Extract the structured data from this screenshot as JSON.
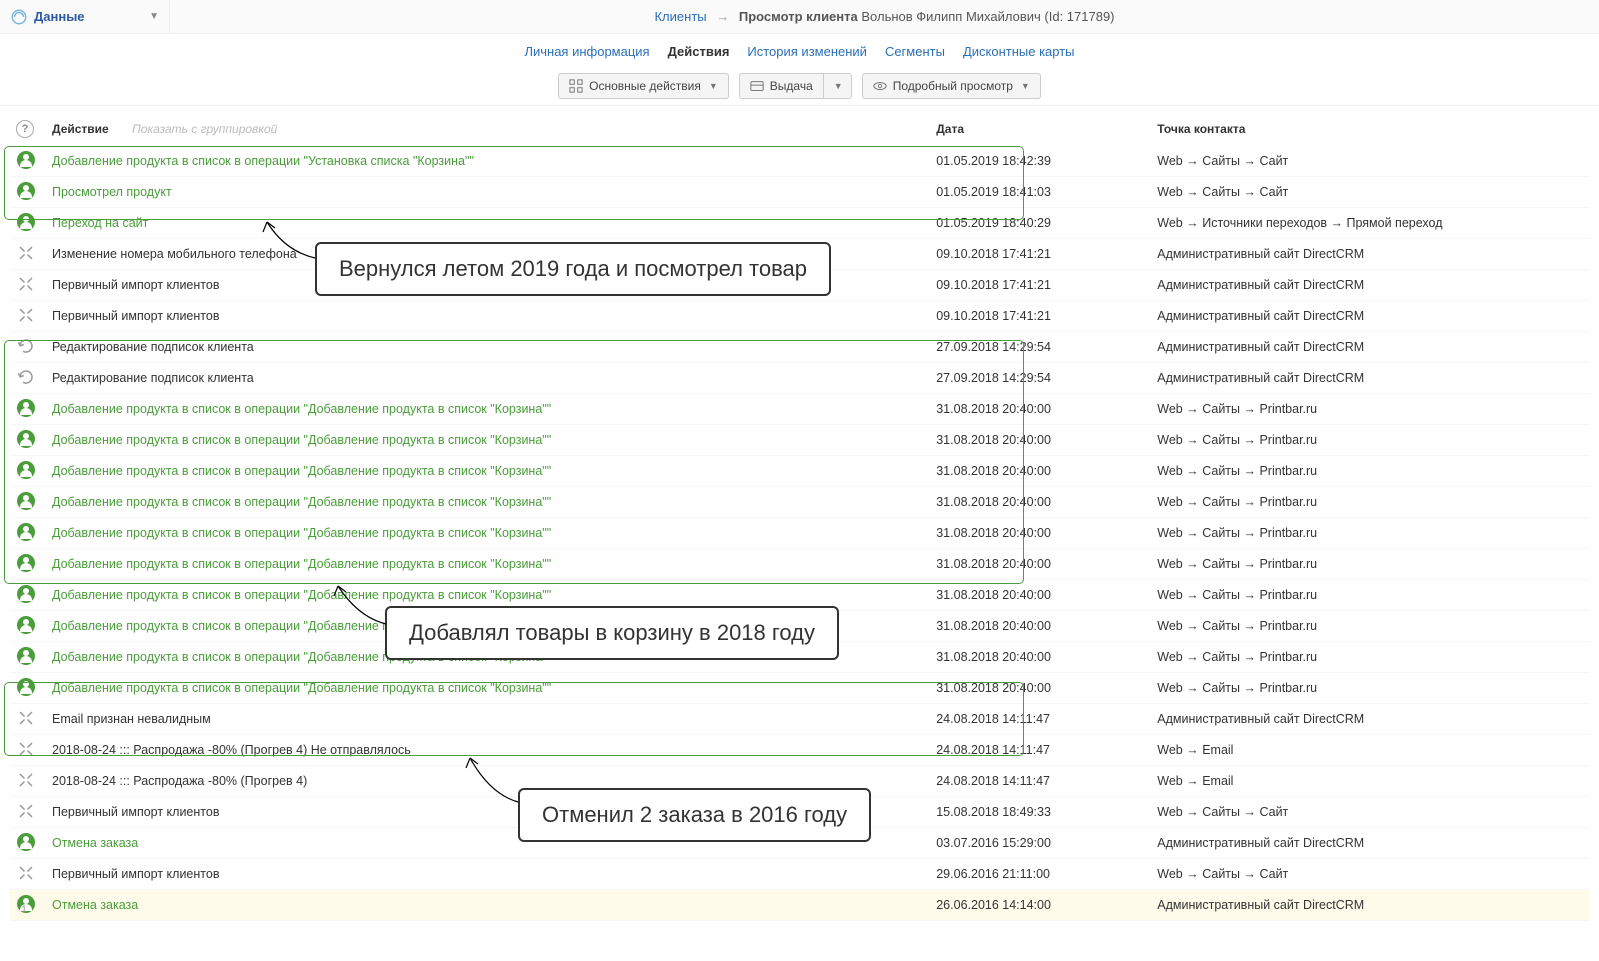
{
  "menu": {
    "label": "Данные"
  },
  "breadcrumb": {
    "clients": "Клиенты",
    "view_client": "Просмотр клиента",
    "client_name": "Вольнов Филипп Михайлович (Id: 171789)"
  },
  "tabs": {
    "personal": "Личная информация",
    "actions": "Действия",
    "history": "История изменений",
    "segments": "Сегменты",
    "discount": "Дисконтные карты"
  },
  "buttons": {
    "main_actions": "Основные действия",
    "issue": "Выдача",
    "detailed_view": "Подробный просмотр"
  },
  "columns": {
    "action": "Действие",
    "grouping": "Показать с группировкой",
    "date": "Дата",
    "point": "Точка контакта"
  },
  "rows": [
    {
      "icon": "person",
      "link": true,
      "action": "Добавление продукта в список в операции \"Установка списка \"Корзина\"\"",
      "date": "01.05.2019 18:42:39",
      "point": "Web → Сайты → Сайт"
    },
    {
      "icon": "person",
      "link": true,
      "action": "Просмотрел продукт",
      "date": "01.05.2019 18:41:03",
      "point": "Web → Сайты → Сайт"
    },
    {
      "icon": "person",
      "link": true,
      "action": "Переход на сайт",
      "date": "01.05.2019 18:40:29",
      "point": "Web → Источники переходов → Прямой переход"
    },
    {
      "icon": "tools",
      "link": false,
      "action": "Изменение номера мобильного телефона",
      "date": "09.10.2018 17:41:21",
      "point": "Административный сайт DirectCRM"
    },
    {
      "icon": "tools",
      "link": false,
      "action": "Первичный импорт клиентов",
      "date": "09.10.2018 17:41:21",
      "point": "Административный сайт DirectCRM"
    },
    {
      "icon": "tools",
      "link": false,
      "action": "Первичный импорт клиентов",
      "date": "09.10.2018 17:41:21",
      "point": "Административный сайт DirectCRM"
    },
    {
      "icon": "undo",
      "link": false,
      "action": "Редактирование подписок клиента",
      "date": "27.09.2018 14:29:54",
      "point": "Административный сайт DirectCRM"
    },
    {
      "icon": "undo",
      "link": false,
      "action": "Редактирование подписок клиента",
      "date": "27.09.2018 14:29:54",
      "point": "Административный сайт DirectCRM"
    },
    {
      "icon": "person",
      "link": true,
      "action": "Добавление продукта в список в операции \"Добавление продукта в список \"Корзина\"\"",
      "date": "31.08.2018 20:40:00",
      "point": "Web → Сайты → Printbar.ru"
    },
    {
      "icon": "person",
      "link": true,
      "action": "Добавление продукта в список в операции \"Добавление продукта в список \"Корзина\"\"",
      "date": "31.08.2018 20:40:00",
      "point": "Web → Сайты → Printbar.ru"
    },
    {
      "icon": "person",
      "link": true,
      "action": "Добавление продукта в список в операции \"Добавление продукта в список \"Корзина\"\"",
      "date": "31.08.2018 20:40:00",
      "point": "Web → Сайты → Printbar.ru"
    },
    {
      "icon": "person",
      "link": true,
      "action": "Добавление продукта в список в операции \"Добавление продукта в список \"Корзина\"\"",
      "date": "31.08.2018 20:40:00",
      "point": "Web → Сайты → Printbar.ru"
    },
    {
      "icon": "person",
      "link": true,
      "action": "Добавление продукта в список в операции \"Добавление продукта в список \"Корзина\"\"",
      "date": "31.08.2018 20:40:00",
      "point": "Web → Сайты → Printbar.ru"
    },
    {
      "icon": "person",
      "link": true,
      "action": "Добавление продукта в список в операции \"Добавление продукта в список \"Корзина\"\"",
      "date": "31.08.2018 20:40:00",
      "point": "Web → Сайты → Printbar.ru"
    },
    {
      "icon": "person",
      "link": true,
      "action": "Добавление продукта в список в операции \"Добавление продукта в список \"Корзина\"\"",
      "date": "31.08.2018 20:40:00",
      "point": "Web → Сайты → Printbar.ru"
    },
    {
      "icon": "person",
      "link": true,
      "action": "Добавление продукта в список в операции \"Добавление продукта в список \"Корзина\"\"",
      "date": "31.08.2018 20:40:00",
      "point": "Web → Сайты → Printbar.ru"
    },
    {
      "icon": "person",
      "link": true,
      "action": "Добавление продукта в список в операции \"Добавление продукта в список \"Корзина\"\"",
      "date": "31.08.2018 20:40:00",
      "point": "Web → Сайты → Printbar.ru"
    },
    {
      "icon": "person",
      "link": true,
      "action": "Добавление продукта в список в операции \"Добавление продукта в список \"Корзина\"\"",
      "date": "31.08.2018 20:40:00",
      "point": "Web → Сайты → Printbar.ru"
    },
    {
      "icon": "tools",
      "link": false,
      "action": "Email признан невалидным",
      "date": "24.08.2018 14:11:47",
      "point": "Административный сайт DirectCRM"
    },
    {
      "icon": "tools",
      "link": false,
      "action": "2018-08-24 ::: Распродажа -80% (Прогрев 4) Не отправлялось",
      "date": "24.08.2018 14:11:47",
      "point": "Web → Email"
    },
    {
      "icon": "tools",
      "link": false,
      "action": "2018-08-24 ::: Распродажа -80% (Прогрев 4)",
      "date": "24.08.2018 14:11:47",
      "point": "Web → Email"
    },
    {
      "icon": "tools",
      "link": false,
      "action": "Первичный импорт клиентов",
      "date": "15.08.2018 18:49:33",
      "point": "Web → Сайты → Сайт"
    },
    {
      "icon": "person",
      "link": true,
      "action": "Отмена заказа",
      "date": "03.07.2016 15:29:00",
      "point": "Административный сайт DirectCRM"
    },
    {
      "icon": "tools",
      "link": false,
      "action": "Первичный импорт клиентов",
      "date": "29.06.2016 21:11:00",
      "point": "Web → Сайты → Сайт"
    },
    {
      "icon": "person-1",
      "link": true,
      "action": "Отмена заказа",
      "date": "26.06.2016 14:14:00",
      "point": "Административный сайт DirectCRM",
      "hl": true
    }
  ],
  "annotations": {
    "a1": "Вернулся летом 2019 года и посмотрел товар",
    "a2": "Добавлял товары в корзину в 2018 году",
    "a3": "Отменил 2 заказа в 2016 году"
  }
}
